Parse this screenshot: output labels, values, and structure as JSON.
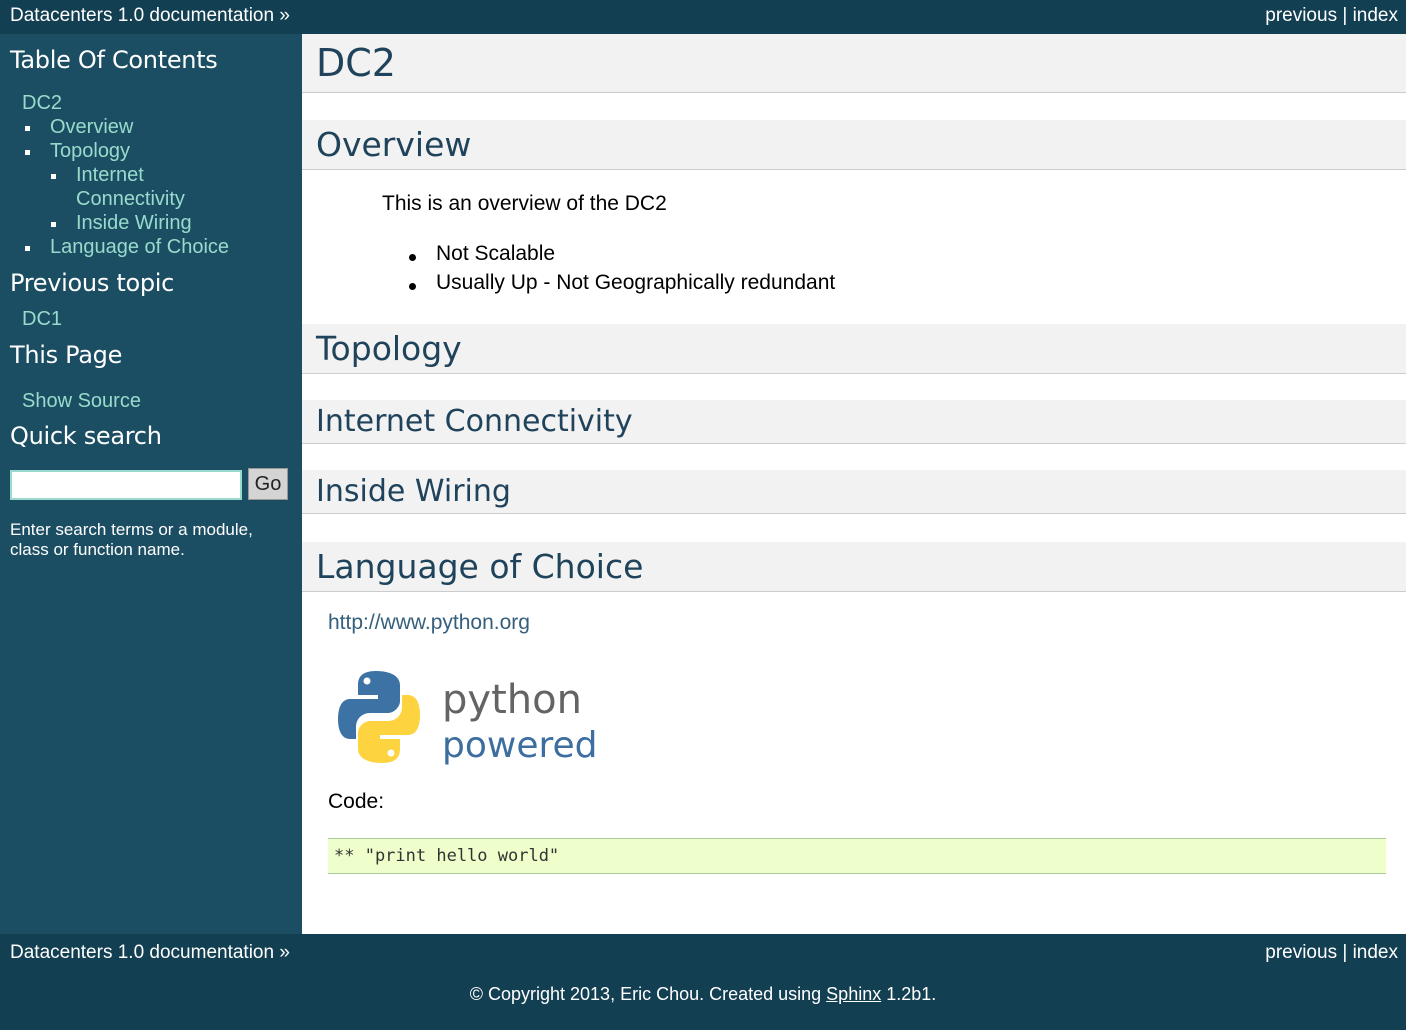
{
  "relbar": {
    "doc_title": "Datacenters 1.0 documentation",
    "doc_arrow": "»",
    "previous": "previous",
    "separator": "|",
    "index": "index"
  },
  "sidebar": {
    "toc_heading": "Table Of Contents",
    "toc": {
      "root": "DC2",
      "overview": "Overview",
      "topology": "Topology",
      "internet_1": "Internet",
      "internet_2": "Connectivity",
      "inside_wiring": "Inside Wiring",
      "language": "Language of Choice"
    },
    "previous_heading": "Previous topic",
    "previous_link": "DC1",
    "this_page_heading": "This Page",
    "show_source": "Show Source",
    "search_heading": "Quick search",
    "search_value": "",
    "search_button": "Go",
    "search_hint": "Enter search terms or a module, class or function name."
  },
  "content": {
    "title": "DC2",
    "overview_heading": "Overview",
    "overview_text": "This is an overview of the DC2",
    "overview_bullets": [
      "Not Scalable",
      "Usually Up - Not Geographically redundant"
    ],
    "topology_heading": "Topology",
    "internet_heading": "Internet Connectivity",
    "inside_wiring_heading": "Inside Wiring",
    "language_heading": "Language of Choice",
    "python_link": "http://www.python.org",
    "logo_text_1": "python",
    "logo_text_2": "powered",
    "code_label": "Code:",
    "code": "** \"print hello world\""
  },
  "footer": {
    "copyright": "© Copyright 2013, Eric Chou. Created using ",
    "sphinx": "Sphinx",
    "version": " 1.2b1."
  },
  "colors": {
    "relbar": "#133f52",
    "sidebar": "#1c4e63",
    "sidebar_link": "#98dbcc",
    "heading_text": "#20435c",
    "heading_bg": "#f2f2f2",
    "code_bg": "#eeffcc"
  }
}
